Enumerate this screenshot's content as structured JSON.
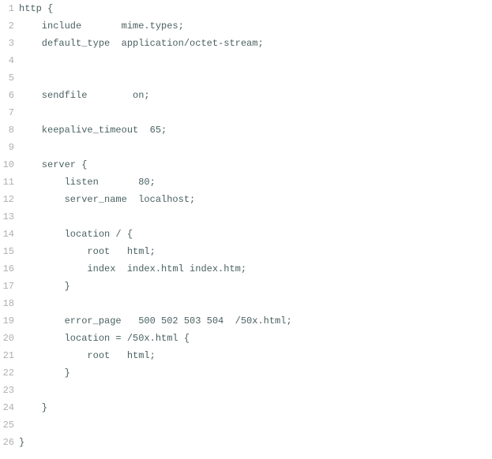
{
  "lines": [
    {
      "num": "1",
      "text": "http {"
    },
    {
      "num": "2",
      "text": "    include       mime.types;"
    },
    {
      "num": "3",
      "text": "    default_type  application/octet-stream;"
    },
    {
      "num": "4",
      "text": ""
    },
    {
      "num": "5",
      "text": ""
    },
    {
      "num": "6",
      "text": "    sendfile        on;"
    },
    {
      "num": "7",
      "text": ""
    },
    {
      "num": "8",
      "text": "    keepalive_timeout  65;"
    },
    {
      "num": "9",
      "text": ""
    },
    {
      "num": "10",
      "text": "    server {"
    },
    {
      "num": "11",
      "text": "        listen       80;"
    },
    {
      "num": "12",
      "text": "        server_name  localhost;"
    },
    {
      "num": "13",
      "text": ""
    },
    {
      "num": "14",
      "text": "        location / {"
    },
    {
      "num": "15",
      "text": "            root   html;"
    },
    {
      "num": "16",
      "text": "            index  index.html index.htm;"
    },
    {
      "num": "17",
      "text": "        }"
    },
    {
      "num": "18",
      "text": ""
    },
    {
      "num": "19",
      "text": "        error_page   500 502 503 504  /50x.html;"
    },
    {
      "num": "20",
      "text": "        location = /50x.html {"
    },
    {
      "num": "21",
      "text": "            root   html;"
    },
    {
      "num": "22",
      "text": "        }"
    },
    {
      "num": "23",
      "text": ""
    },
    {
      "num": "24",
      "text": "    }"
    },
    {
      "num": "25",
      "text": ""
    },
    {
      "num": "26",
      "text": "}"
    }
  ]
}
